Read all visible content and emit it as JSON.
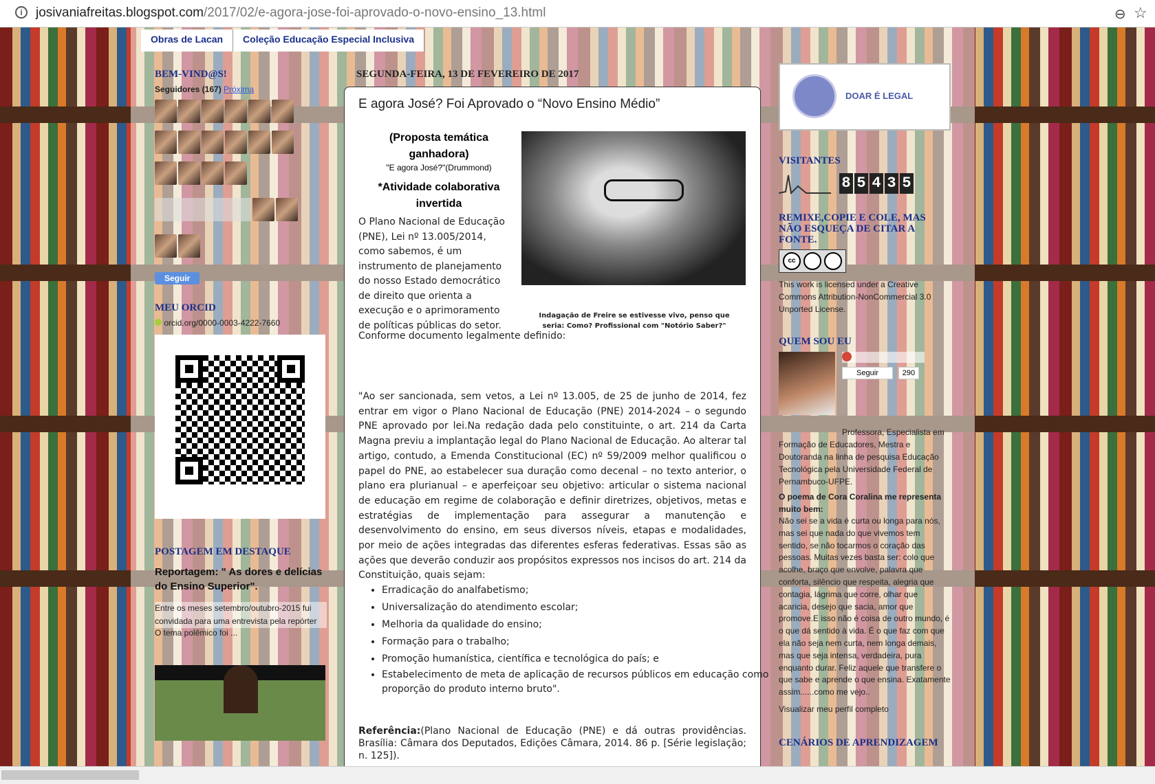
{
  "browser": {
    "url_host": "josivaniafreitas.blogspot.com",
    "url_path": "/2017/02/e-agora-jose-foi-aprovado-o-novo-ensino_13.html"
  },
  "tabs": [
    "Obras de Lacan",
    "Coleção Educação Especial Inclusiva"
  ],
  "left": {
    "welcome_title": "BEM-VIND@S!",
    "followers_label": "Seguidores (167)",
    "followers_next": "Próxima",
    "follow_button": "Seguir",
    "orcid_title": "MEU ORCID",
    "orcid_link": "orcid.org/0000-0003-4222-7660",
    "featured_title": "POSTAGEM EM DESTAQUE",
    "featured_post_title": "Reportagem: \" As dores e delícias do Ensino Superior\".",
    "featured_excerpt": "Entre os meses setembro/outubro-2015 fui convidada para uma entrevista pela repórter",
    "featured_excerpt2": "O tema polêmico foi ..."
  },
  "post": {
    "date_header": "SEGUNDA-FEIRA, 13 DE FEVEREIRO DE 2017",
    "title": "E agora José? Foi Aprovado o “Novo Ensino Médio”",
    "proposal_heading": "(Proposta temática ganhadora)",
    "proposal_sub": "\"E agora José?\"(Drummond)",
    "activity_heading": "*Atividade colaborativa invertida",
    "intro": "O Plano Nacional de Educação (PNE), Lei nº 13.005/2014, como sabemos, é um instrumento de planejamento do nosso Estado democrático de direito que orienta a execução e o aprimoramento de políticas públicas do setor.",
    "intro2": "Conforme documento legalmente definido:",
    "image_caption": "Indagação de Freire se estivesse vivo, penso que seria: Como? Profissional com \"Notório Saber?\"",
    "quote": "\"Ao ser sancionada, sem vetos, a Lei nº 13.005, de 25 de junho de 2014, fez entrar em vigor o Plano Nacional de Educação (PNE) 2014-2024 – o segundo PNE aprovado por lei.Na redação dada pelo constituinte, o art. 214 da Carta Magna previu a implantação legal do Plano Nacional de Educação. Ao alterar tal artigo, contudo, a Emenda Constitucional (EC) nº 59/2009 melhor qualificou o papel do PNE, ao estabelecer sua duração como decenal – no texto anterior, o plano era plurianual – e aperfeiçoar seu objetivo: articular o sistema nacional de educação em regime de colaboração e definir diretrizes, objetivos, metas e estratégias de implementação para assegurar a manutenção e desenvolvimento do ensino, em seus diversos níveis, etapas e modalidades, por meio de ações integradas das diferentes esferas federativas. Essas são as ações que deverão conduzir aos propósitos expressos nos incisos do art. 214 da Constituição, quais sejam:",
    "bullets": [
      "Erradicação do analfabetismo;",
      "Universalização do atendimento escolar;",
      "Melhoria da qualidade do ensino;",
      "Formação para o trabalho;",
      "Promoção humanística, científica e tecnológica do país; e",
      "Estabelecimento de meta de aplicação de recursos públicos em educação como proporção do produto interno bruto\"."
    ],
    "ref_label": "Referência:",
    "ref_text": "(Plano Nacional de Educação (PNE) e dá outras providências. Brasília: Câmara dos Deputados, Edições Câmara, 2014. 86 p. [Série legislação; n. 125])."
  },
  "right": {
    "banner_text": "DOAR É LEGAL",
    "visitors_title": "VISITANTES",
    "visitor_count": [
      "8",
      "5",
      "4",
      "3",
      "5"
    ],
    "remix_title": "REMIXE,COPIE E COLE, MAS NÃO ESQUEÇA DE CITAR A FONTE.",
    "license_text": "This work is licensed under a Creative Commons Attribution-NonCommercial 3.0 Unported License.",
    "who_title": "QUEM SOU EU",
    "follow_label": "Seguir",
    "follow_count": "290",
    "bio": "Professora, Especialista em Formação de Educadores, Mestra e Doutoranda na linha de pesquisa Educação Tecnológica pela Universidade Federal de Pernambuco-UFPE.",
    "poem_heading": "O poema de Cora Coralina me representa muito bem:",
    "poem": "Não sei se a vida é curta ou longa para nós, mas sei que nada do que vivemos tem sentido, se não tocarmos o coração das pessoas. Muitas vezes basta ser: colo que acolhe, braço que envolve, palavra que conforta, silêncio que respeita, alegria que contagia, lágrima que corre, olhar que acaricia, desejo que sacia, amor que promove.E isso não é coisa de outro mundo, é o que dá sentido à vida. É o que faz com que ela não seja nem curta, nem longa demais, mas que seja intensa, verdadeira, pura enquanto durar. Feliz aquele que transfere o que sabe e aprende o que ensina. Exatamente assim......como me vejo..",
    "profile_link": "Visualizar meu perfil completo",
    "scenarios_title": "CENÁRIOS DE APRENDIZAGEM"
  }
}
